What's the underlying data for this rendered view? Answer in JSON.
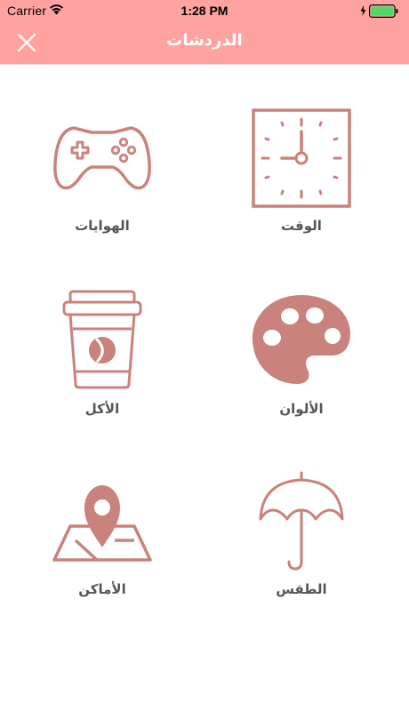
{
  "status_bar": {
    "carrier": "Carrier",
    "time": "1:28 PM",
    "battery_color": "#4cd964"
  },
  "nav": {
    "title": "الدردشات",
    "close_icon": "close-icon",
    "bar_color": "#ffa3a0"
  },
  "colors": {
    "icon": "#c9827c",
    "label": "#555555"
  },
  "categories": [
    {
      "label": "الوقت",
      "icon": "clock-icon"
    },
    {
      "label": "الهوايات",
      "icon": "gamepad-icon"
    },
    {
      "label": "الألوان",
      "icon": "palette-icon"
    },
    {
      "label": "الأكل",
      "icon": "coffee-cup-icon"
    },
    {
      "label": "الطقس",
      "icon": "umbrella-icon"
    },
    {
      "label": "الأماكن",
      "icon": "map-pin-icon"
    }
  ]
}
